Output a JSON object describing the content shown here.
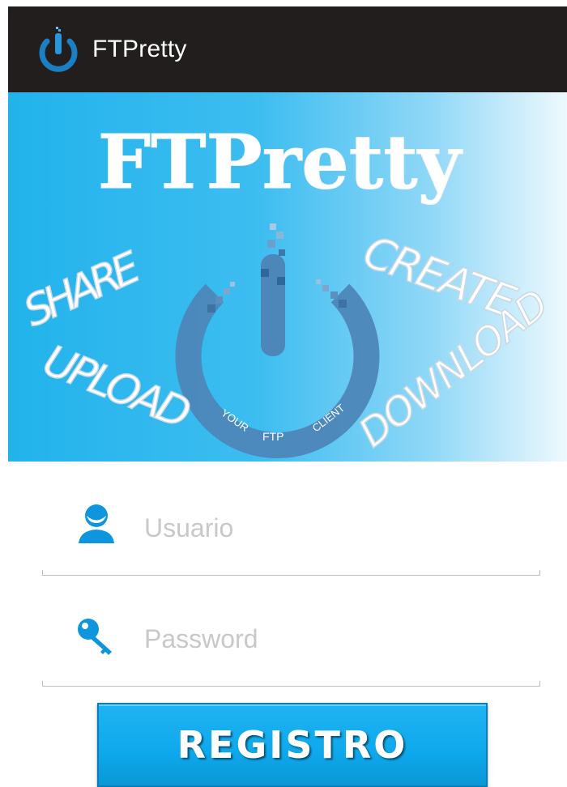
{
  "app": {
    "title": "FTPretty",
    "icon": "power-icon"
  },
  "banner": {
    "logo_text": "FTPretty",
    "words": [
      "SHARE",
      "UPLOAD",
      "CREATE",
      "DOWNLOAD"
    ],
    "ring_words": [
      "YOUR",
      "FTP",
      "CLIENT"
    ],
    "logo_icon": "power-icon"
  },
  "form": {
    "username": {
      "placeholder": "Usuario",
      "value": "",
      "icon": "user-icon"
    },
    "password": {
      "placeholder": "Password",
      "value": "",
      "icon": "key-icon"
    },
    "submit_label": "REGISTRO"
  },
  "colors": {
    "actionbar": "#211e1d",
    "accent": "#0ea8ec",
    "icon_blue": "#0d96dd",
    "banner_blue": "#22b3ec"
  }
}
